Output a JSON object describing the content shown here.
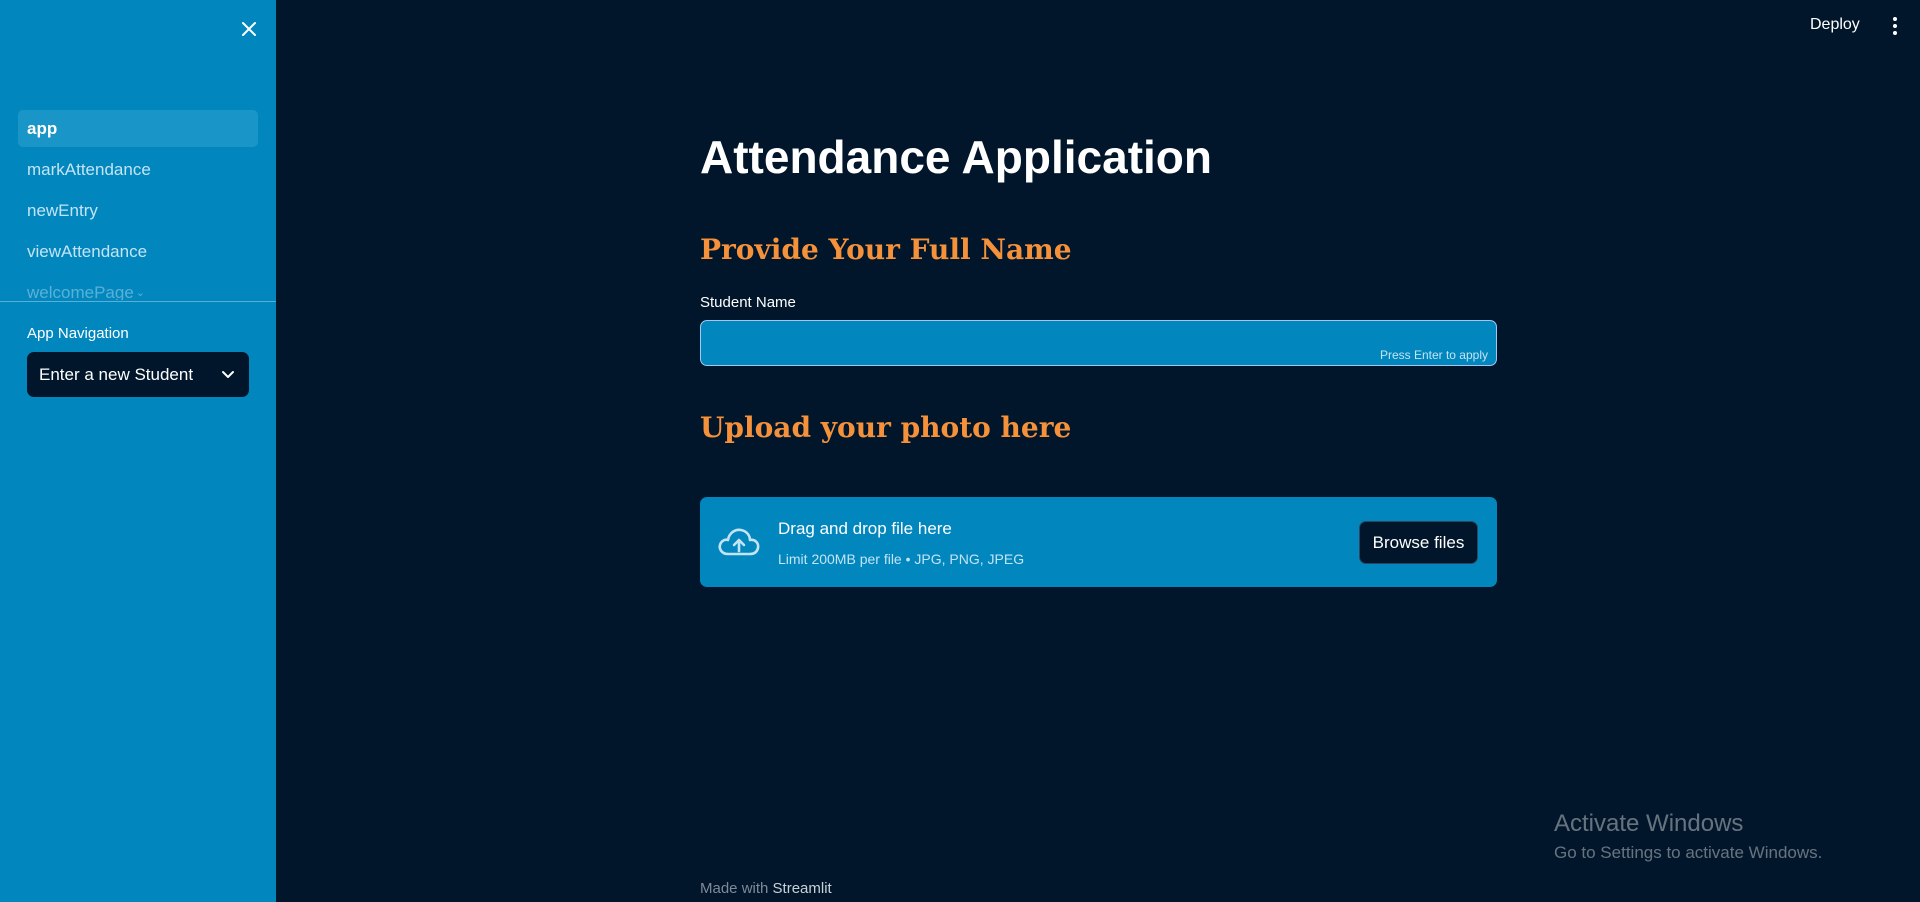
{
  "sidebar": {
    "items": [
      {
        "label": "app",
        "active": true
      },
      {
        "label": "markAttendance"
      },
      {
        "label": "newEntry"
      },
      {
        "label": "viewAttendance"
      },
      {
        "label": "welcomePage"
      }
    ],
    "navigation_caption": "App Navigation",
    "navigation_select_value": "Enter a new Student",
    "close_icon": "close-icon"
  },
  "topbar": {
    "deploy_label": "Deploy",
    "menu_icon": "more-vert-icon"
  },
  "main": {
    "title": "Attendance Application",
    "name_heading": "Provide Your Full Name",
    "name_field_label": "Student Name",
    "name_field_value": "",
    "name_field_hint": "Press Enter to apply",
    "upload_heading": "Upload your photo here",
    "uploader": {
      "title": "Drag and drop file here",
      "subtitle": "Limit 200MB per file • JPG, PNG, JPEG",
      "browse_label": "Browse files",
      "icon": "cloud-upload-icon"
    }
  },
  "footer": {
    "prefix": "Made with",
    "brand": "Streamlit"
  },
  "watermark": {
    "title": "Activate Windows",
    "subtitle": "Go to Settings to activate Windows."
  },
  "colors": {
    "sidebar_bg": "#0286be",
    "main_bg": "#01162b",
    "heading_accent": "#f5913a"
  }
}
